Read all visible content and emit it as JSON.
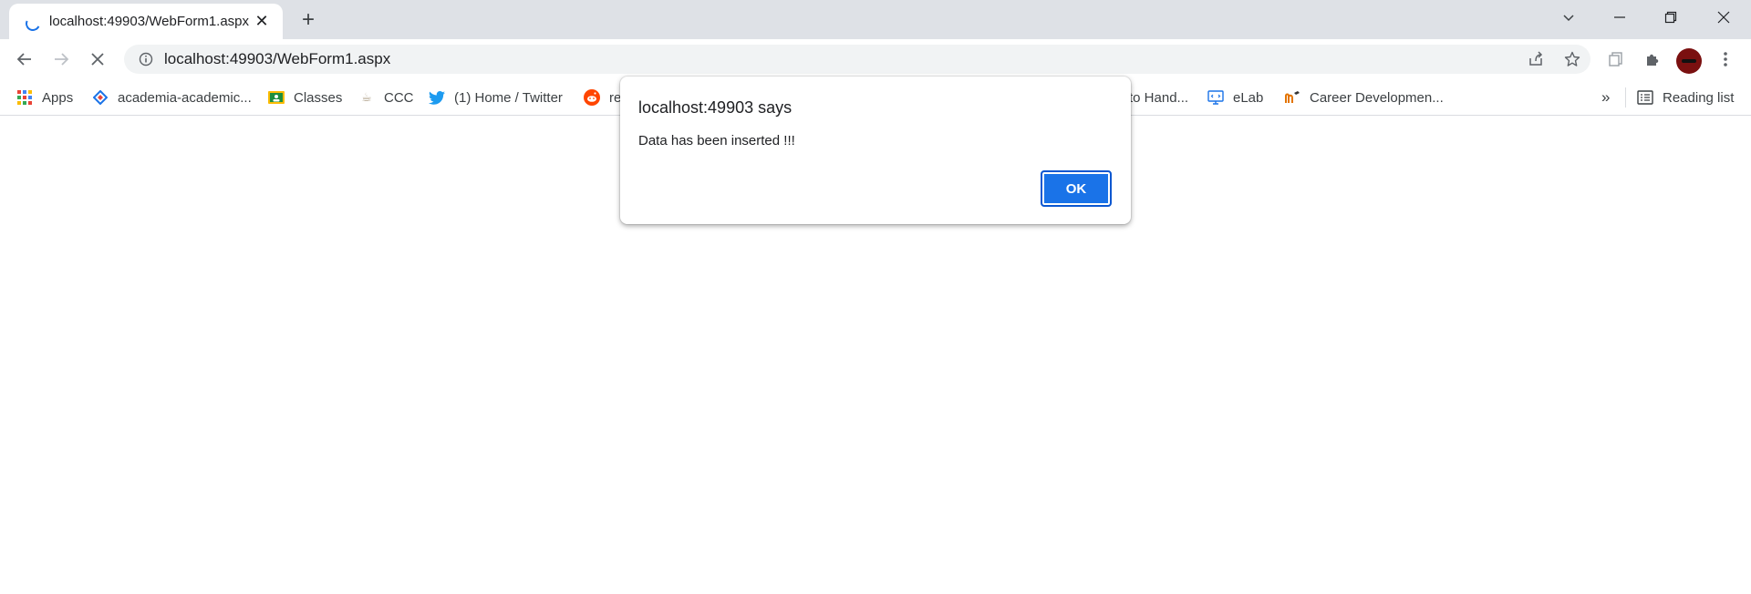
{
  "tab": {
    "title": "localhost:49903/WebForm1.aspx",
    "close": "✕"
  },
  "new_tab": "+",
  "address_bar": {
    "url": "localhost:49903/WebForm1.aspx"
  },
  "bookmarks": [
    {
      "label": "Apps",
      "icon": "apps-grid-icon"
    },
    {
      "label": "academia-academic...",
      "icon": "diamond-icon"
    },
    {
      "label": "Classes",
      "icon": "classroom-icon"
    },
    {
      "label": "CCC",
      "icon": "ccc-icon"
    },
    {
      "label": "(1) Home / Twitter",
      "icon": "twitter-icon"
    },
    {
      "label": "re",
      "icon": "reddit-icon"
    },
    {
      "label": "to Hand...",
      "icon": ""
    },
    {
      "label": "eLab",
      "icon": "elab-icon"
    },
    {
      "label": "Career Developmen...",
      "icon": "mooc-icon"
    }
  ],
  "bookmarks_overflow": "»",
  "reading_list": "Reading list",
  "dialog": {
    "title": "localhost:49903 says",
    "message": "Data has been inserted !!!",
    "ok_label": "OK"
  },
  "colors": {
    "accent": "#1a73e8",
    "tabstrip": "#dee1e6",
    "omnibox": "#f1f3f4",
    "twitter": "#1d9bf0",
    "reddit": "#ff4500"
  }
}
